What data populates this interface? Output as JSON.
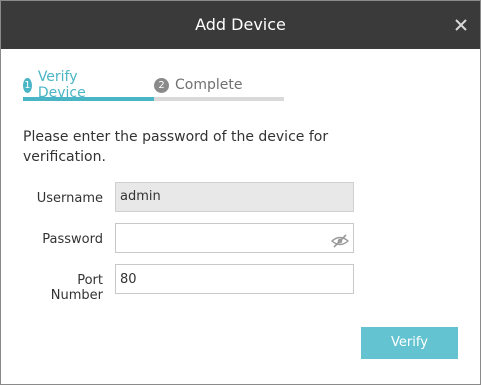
{
  "dialog": {
    "title": "Add Device",
    "close_icon": "close-icon"
  },
  "steps": [
    {
      "number": "1",
      "label": "Verify Device",
      "active": true
    },
    {
      "number": "2",
      "label": "Complete",
      "active": false
    }
  ],
  "progress": {
    "fraction": 0.5
  },
  "instruction": "Please enter the password of the device for verification.",
  "form": {
    "username_label": "Username",
    "username_value": "admin",
    "password_label": "Password",
    "password_value": "",
    "password_toggle_icon": "eye-hidden-icon",
    "port_label": "Port Number",
    "port_value": "80"
  },
  "verify_button": "Verify",
  "colors": {
    "accent": "#4ab5c4",
    "button": "#64c3d0",
    "titlebar": "#3a3a3a"
  }
}
